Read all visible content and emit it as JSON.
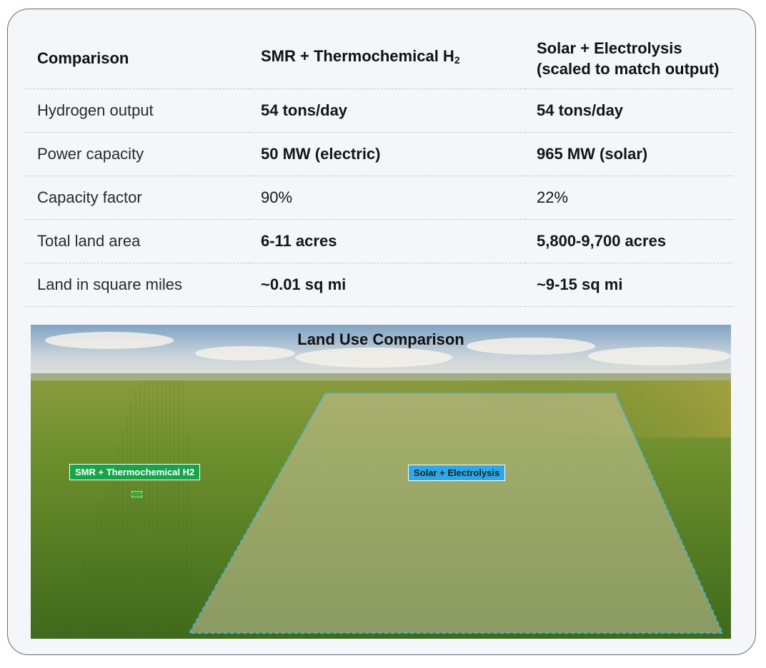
{
  "table": {
    "headers": {
      "comparison": "Comparison",
      "smr_main": "SMR + Thermochemical H",
      "smr_sub": "2",
      "solar_line1": "Solar + Electrolysis",
      "solar_line2": "(scaled to match output)"
    },
    "rows": [
      {
        "metric": "Hydrogen output",
        "smr": "54 tons/day",
        "solar": "54 tons/day"
      },
      {
        "metric": "Power capacity",
        "smr": "50 MW (electric)",
        "solar": "965 MW (solar)"
      },
      {
        "metric": "Capacity factor",
        "smr": "90%",
        "solar": "22%"
      },
      {
        "metric": "Total land area",
        "smr": "6-11 acres",
        "solar": "5,800-9,700 acres"
      },
      {
        "metric": "Land in square miles",
        "smr": "~0.01 sq mi",
        "solar": "~9-15 sq mi"
      }
    ]
  },
  "photo": {
    "title": "Land Use Comparison",
    "smr_label": "SMR + Thermochemical H2",
    "solar_label": "Solar + Electrolysis",
    "colors": {
      "smr_label_bg": "#16a34a",
      "solar_label_bg": "#2fa9e4",
      "solar_outline": "#3fb6e8"
    }
  }
}
